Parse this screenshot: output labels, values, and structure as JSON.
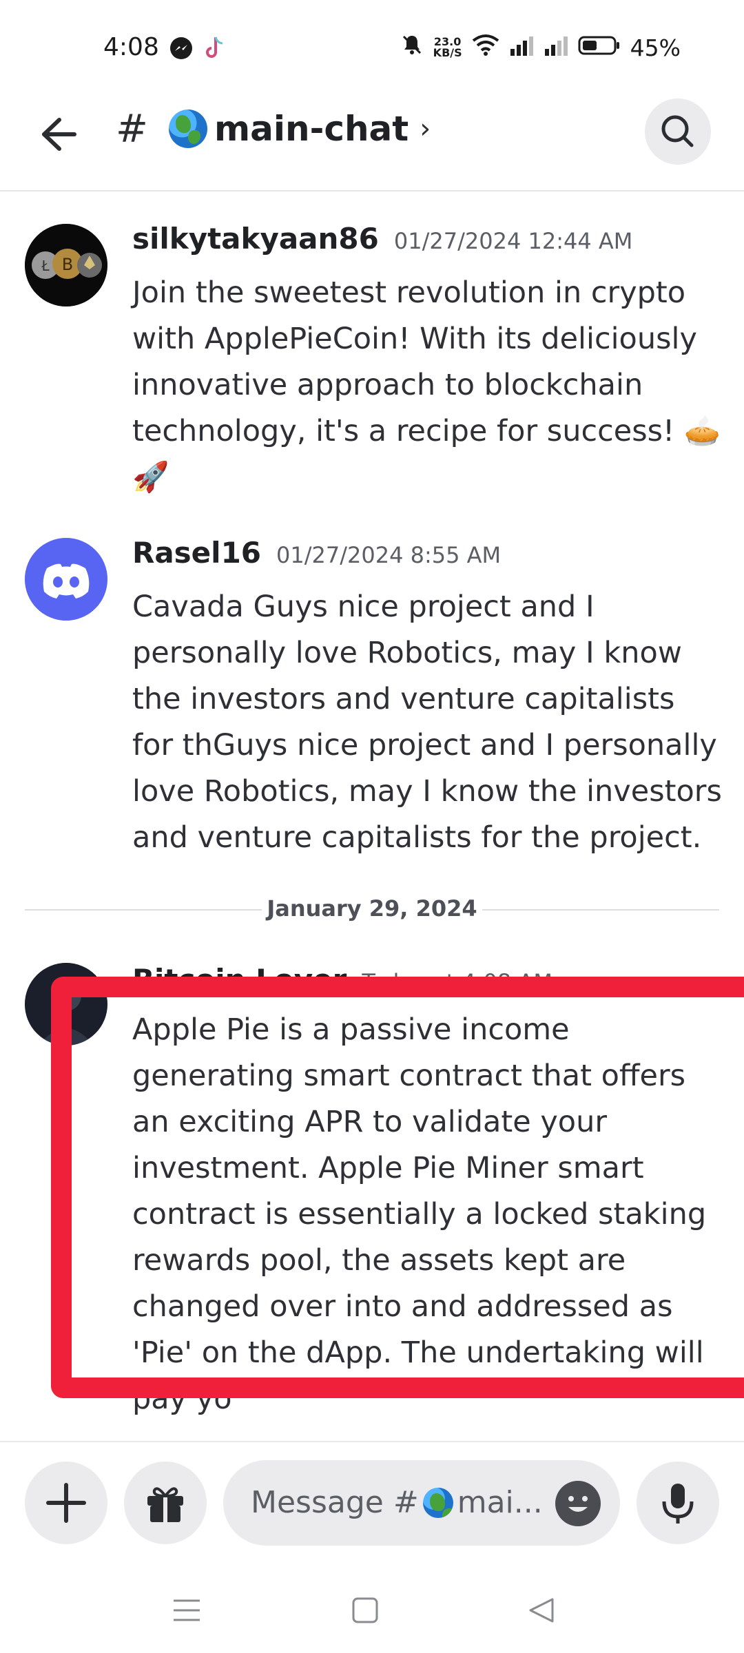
{
  "status_bar": {
    "time": "4:08",
    "net_speed_value": "23.0",
    "net_speed_unit": "KB/S",
    "battery": "45%"
  },
  "header": {
    "hash": "#",
    "channel_name": "main-chat",
    "chevron": "›"
  },
  "messages": [
    {
      "author": "silkytakyaan86",
      "timestamp": "01/27/2024 12:44 AM",
      "text": "Join the sweetest revolution in crypto with ApplePieCoin! With its deliciously innovative approach to blockchain technology, it's a recipe for success! 🥧",
      "emoji_line": "🚀"
    },
    {
      "author": "Rasel16",
      "timestamp": "01/27/2024 8:55 AM",
      "text": "Cavada Guys nice project and I personally love Robotics, may I know the investors and venture capitalists for thGuys nice project and I personally love Robotics, may I know the investors and venture capitalists for the project."
    },
    {
      "author": "Bitcoin Lover",
      "timestamp": "Today at 4:08 AM",
      "text": "Apple Pie is a passive income generating smart contract that offers an exciting APR to validate your investment. Apple Pie Miner smart contract is essentially a locked staking rewards pool, the assets kept are changed over into and addressed as 'Pie' on the dApp. The undertaking will pay yo"
    }
  ],
  "date_separator": "January 29, 2024",
  "composer": {
    "placeholder_prefix": "Message #",
    "placeholder_suffix": "mai..."
  },
  "colors": {
    "highlight": "#f01f3a",
    "discord_blurple": "#5865f2"
  }
}
